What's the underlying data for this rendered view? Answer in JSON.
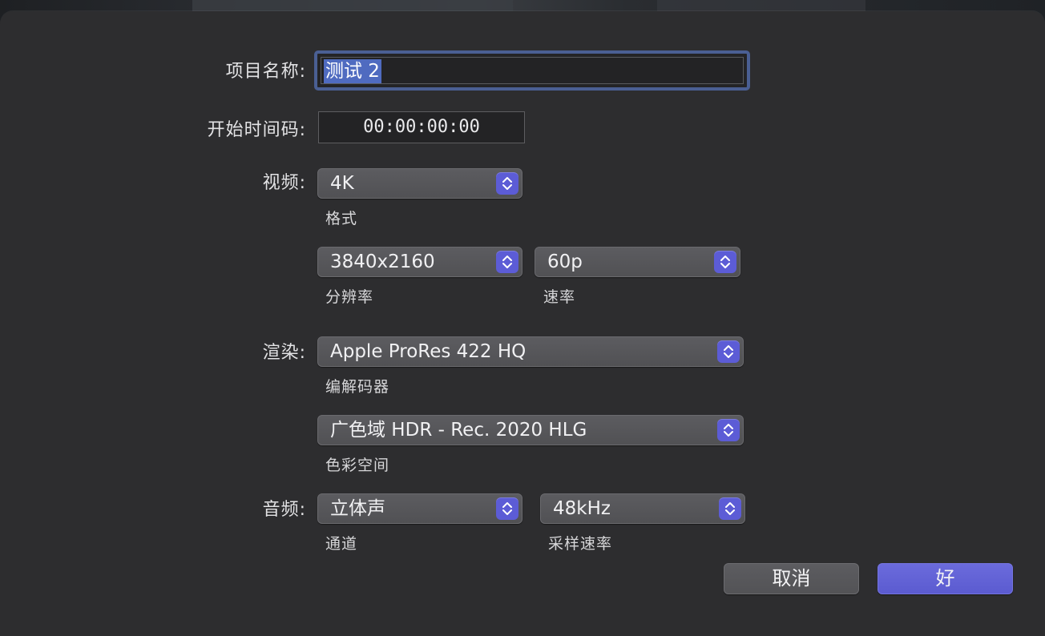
{
  "project_name": {
    "label": "项目名称:",
    "value": "测试 2"
  },
  "start_timecode": {
    "label": "开始时间码:",
    "value": "00:00:00:00"
  },
  "video": {
    "label": "视频:",
    "format": {
      "value": "4K",
      "caption": "格式"
    },
    "resolution": {
      "value": "3840x2160",
      "caption": "分辨率"
    },
    "rate": {
      "value": "60p",
      "caption": "速率"
    }
  },
  "rendering": {
    "label": "渲染:",
    "codec": {
      "value": "Apple ProRes 422 HQ",
      "caption": "编解码器"
    },
    "color_space": {
      "value": "广色域 HDR - Rec. 2020 HLG",
      "caption": "色彩空间"
    }
  },
  "audio": {
    "label": "音频:",
    "channels": {
      "value": "立体声",
      "caption": "通道"
    },
    "sample_rate": {
      "value": "48kHz",
      "caption": "采样速率"
    }
  },
  "buttons": {
    "cancel": "取消",
    "ok": "好"
  },
  "icons": {
    "popup_indicator": "up-down-chevron-icon"
  },
  "colors": {
    "accent": "#5c5cd6",
    "focus_ring": "#4a5f93",
    "selection": "#4f6bc0",
    "dialog_background": "#2d2d2f"
  }
}
